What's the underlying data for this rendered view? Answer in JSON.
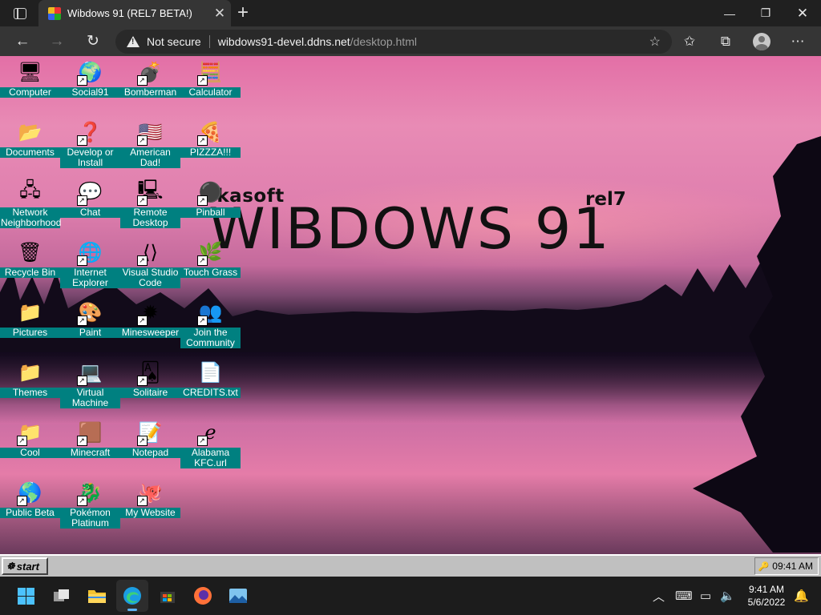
{
  "browser": {
    "tab_title": "Wibdows 91 (REL7 BETA!)",
    "close_tab_glyph": "✕",
    "new_tab_glyph": "+",
    "security_text": "Not secure",
    "url_host": "wibdows91-devel.ddns.net",
    "url_path": "/desktop.html"
  },
  "desktop": {
    "logo_brand": "ikasoft",
    "logo_title": "WIBDOWS 91",
    "logo_rel": "rel7",
    "icons": [
      {
        "label": "Computer",
        "glyph": "🖥",
        "icon": "computer-icon"
      },
      {
        "label": "Social91",
        "glyph": "🌍",
        "icon": "social-globe-icon"
      },
      {
        "label": "Bomberman",
        "glyph": "💣",
        "icon": "bomberman-icon"
      },
      {
        "label": "Calculator",
        "glyph": "🧮",
        "icon": "calculator-icon"
      },
      {
        "label": "Documents",
        "glyph": "📂",
        "icon": "documents-folder-icon"
      },
      {
        "label": "Develop or Install",
        "glyph": "❓",
        "icon": "develop-install-icon"
      },
      {
        "label": "American Dad!",
        "glyph": "🇺🇸",
        "icon": "us-flag-icon"
      },
      {
        "label": "PIZZZA!!!",
        "glyph": "🍕",
        "icon": "pizza-icon"
      },
      {
        "label": "Network Neighborhood",
        "glyph": "🖧",
        "icon": "network-icon"
      },
      {
        "label": "Chat",
        "glyph": "💬",
        "icon": "chat-bubble-icon"
      },
      {
        "label": "Remote Desktop",
        "glyph": "🖳",
        "icon": "remote-desktop-icon"
      },
      {
        "label": "Pinball",
        "glyph": "⚫",
        "icon": "pinball-icon"
      },
      {
        "label": "Recycle Bin",
        "glyph": "🗑",
        "icon": "recycle-bin-icon"
      },
      {
        "label": "Internet Explorer",
        "glyph": "🌐",
        "icon": "internet-explorer-icon"
      },
      {
        "label": "Visual Studio Code",
        "glyph": "⟨⟩",
        "icon": "vscode-icon"
      },
      {
        "label": "Touch Grass",
        "glyph": "🌿",
        "icon": "grass-icon"
      },
      {
        "label": "Pictures",
        "glyph": "📁",
        "icon": "pictures-folder-icon"
      },
      {
        "label": "Paint",
        "glyph": "🎨",
        "icon": "paint-icon"
      },
      {
        "label": "Minesweeper",
        "glyph": "✹",
        "icon": "minesweeper-icon"
      },
      {
        "label": "Join the Community",
        "glyph": "👥",
        "icon": "community-icon"
      },
      {
        "label": "Themes",
        "glyph": "📁",
        "icon": "themes-folder-icon"
      },
      {
        "label": "Virtual Machine",
        "glyph": "💻",
        "icon": "virtual-machine-icon"
      },
      {
        "label": "Solitaire",
        "glyph": "🂡",
        "icon": "solitaire-icon"
      },
      {
        "label": "CREDITS.txt",
        "glyph": "📄",
        "icon": "text-file-icon"
      },
      {
        "label": "Cool",
        "glyph": "📁",
        "icon": "cool-folder-icon"
      },
      {
        "label": "Minecraft",
        "glyph": "🟫",
        "icon": "minecraft-icon"
      },
      {
        "label": "Notepad",
        "glyph": "📝",
        "icon": "notepad-icon"
      },
      {
        "label": "Alabama KFC.url",
        "glyph": "ℯ",
        "icon": "internet-shortcut-icon"
      },
      {
        "label": "Public Beta",
        "glyph": "🌎",
        "icon": "public-beta-icon"
      },
      {
        "label": "Pokémon Platinum",
        "glyph": "🐉",
        "icon": "pokemon-icon"
      },
      {
        "label": "My Website",
        "glyph": "🐙",
        "icon": "github-icon"
      }
    ]
  },
  "wibdows_taskbar": {
    "start_label": "start",
    "clock": "09:41 AM"
  },
  "os_taskbar": {
    "time": "9:41 AM",
    "date": "5/6/2022"
  },
  "colors": {
    "icon_label_bg": "#008080",
    "taskbar_gray": "#c0c0c0",
    "os_accent": "#4cc2ff"
  }
}
